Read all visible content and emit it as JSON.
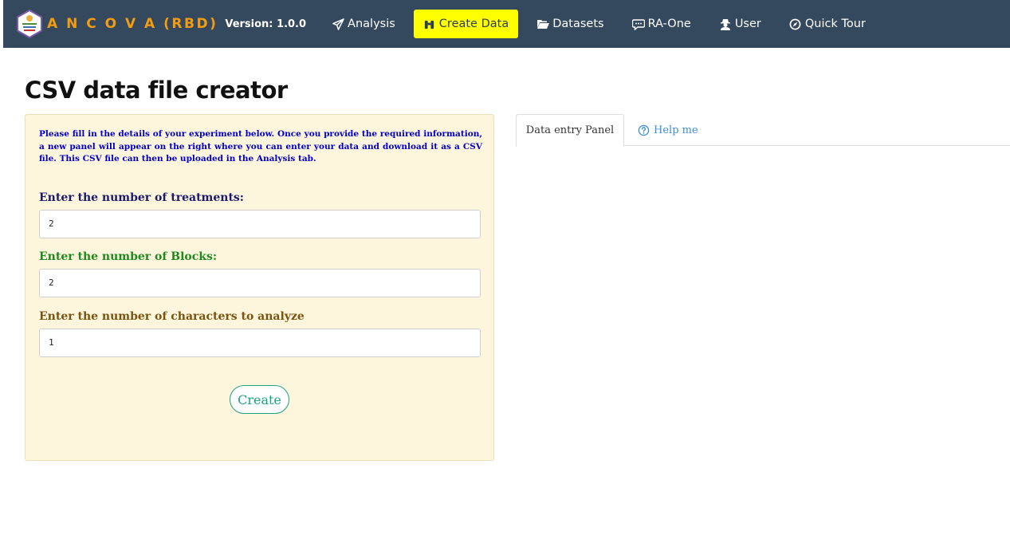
{
  "app": {
    "title": "A N C O V A (RBD)",
    "version": "Version: 1.0.0",
    "logo": "hexagon-logo-badge"
  },
  "nav": {
    "items": [
      {
        "label": "Analysis",
        "icon": "paper-plane-icon",
        "active": false
      },
      {
        "label": "Create Data",
        "icon": "binoculars-icon",
        "active": true
      },
      {
        "label": "Datasets",
        "icon": "folder-open-icon",
        "active": false
      },
      {
        "label": "RA-One",
        "icon": "chat-bubble-icon",
        "active": false
      },
      {
        "label": "User",
        "icon": "user-secret-icon",
        "active": false
      },
      {
        "label": "Quick Tour",
        "icon": "compass-icon",
        "active": false
      }
    ]
  },
  "page": {
    "title": "CSV data file creator"
  },
  "form": {
    "intro": "Please fill in the details of your experiment below. Once you provide the required information, a new panel will appear on the right where you can enter your data and download it as a CSV file. This CSV file can then be uploaded in the Analysis tab.",
    "treatments_label": "Enter the number of treatments:",
    "treatments_value": "2",
    "blocks_label": "Enter the number of Blocks:",
    "blocks_value": "2",
    "characters_label": "Enter the number of characters to analyze",
    "characters_value": "1",
    "create_label": "Create"
  },
  "tabs": {
    "data_entry": "Data entry Panel",
    "help": "Help me"
  },
  "colors": {
    "navbar": "#34495e",
    "brand": "#f39c12",
    "active_nav": "#ffff00",
    "panel_bg": "#fdf5dc",
    "intro_text": "#0000cc",
    "treatments_label": "#1a1a6e",
    "blocks_label": "#1e8a1e",
    "characters_label": "#7a5310",
    "create_button": "#1aa383",
    "help_link": "#3c8dd9"
  }
}
